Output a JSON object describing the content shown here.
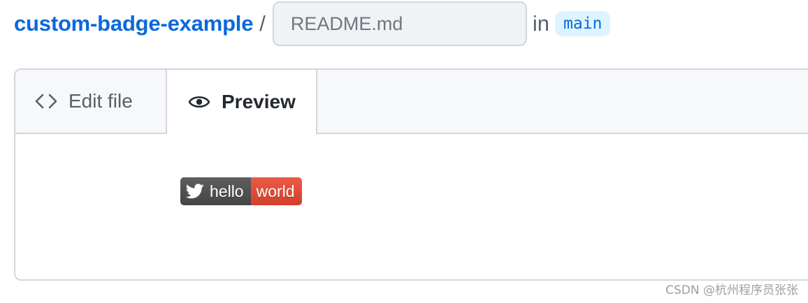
{
  "header": {
    "repo_name": "custom-badge-example",
    "separator": "/",
    "filename_placeholder": "README.md",
    "in_text": "in",
    "branch": "main"
  },
  "tabs": [
    {
      "label": "Edit file",
      "icon": "code-icon",
      "active": false
    },
    {
      "label": "Preview",
      "icon": "eye-icon",
      "active": true
    }
  ],
  "preview": {
    "badge": {
      "icon": "twitter-bird-icon",
      "left_text": "hello",
      "right_text": "world",
      "left_color": "#555555",
      "right_color": "#e05d44"
    }
  },
  "colors": {
    "link": "#0969da",
    "border": "#d0d7de",
    "tabbar_bg": "#f6f8fa",
    "branch_bg": "#ddf4ff"
  },
  "watermark": "CSDN @杭州程序员张张"
}
